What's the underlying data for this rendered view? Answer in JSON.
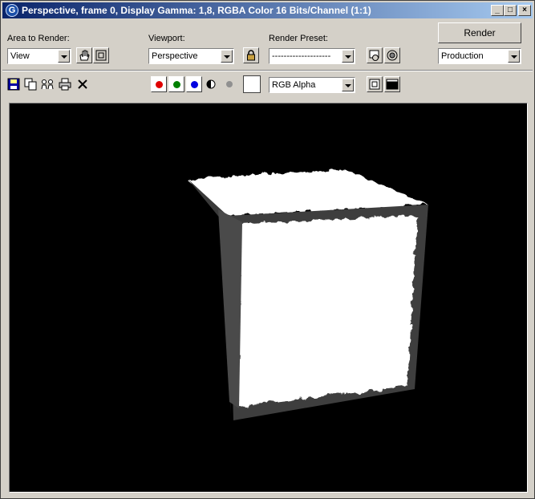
{
  "window": {
    "title": "Perspective, frame 0, Display Gamma: 1,8, RGBA Color 16 Bits/Channel (1:1)",
    "app_icon": "G",
    "minimize_glyph": "_",
    "maximize_glyph": "□",
    "close_glyph": "×"
  },
  "controls": {
    "area_label": "Area to Render:",
    "area_value": "View",
    "viewport_label": "Viewport:",
    "viewport_value": "Perspective",
    "preset_label": "Render Preset:",
    "preset_value": "--------------------",
    "render_button": "Render",
    "render_mode": "Production"
  },
  "toolbar": {
    "channel_value": "RGB Alpha",
    "icons": [
      "save-icon",
      "copy-icon",
      "clone-icon",
      "print-icon",
      "clear-icon"
    ]
  },
  "colors": {
    "red_channel": "#e00000",
    "green_channel": "#008000",
    "blue_channel": "#0000e0",
    "title_start": "#0a246a",
    "title_end": "#a6caf0",
    "viewport_bg": "#000000"
  }
}
